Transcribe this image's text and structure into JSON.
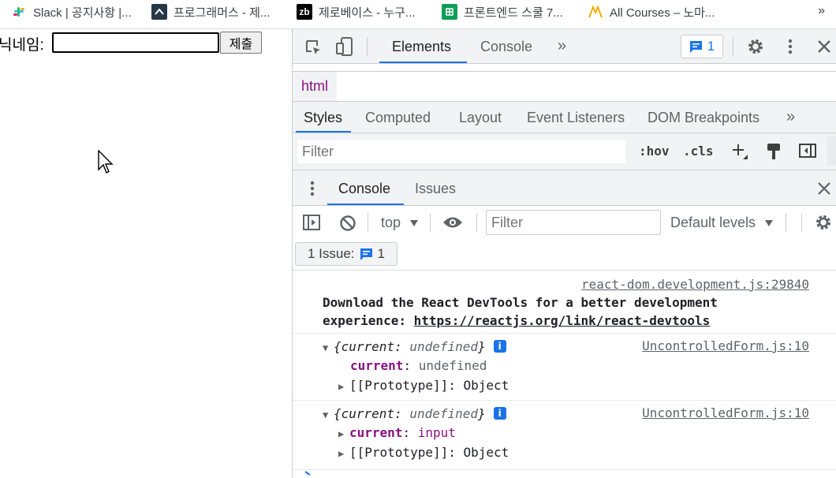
{
  "bookmarks": [
    {
      "label": "Slack | 공지사항 |...",
      "icon": "slack-icon",
      "color": "#e01e5a"
    },
    {
      "label": "프로그래머스 - 제...",
      "icon": "programmers-icon",
      "color": "#263747"
    },
    {
      "label": "제로베이스 - 누구...",
      "icon": "zerobase-icon",
      "color": "#000000",
      "glyph": "zb"
    },
    {
      "label": "프론트엔드 스쿨 7...",
      "icon": "sheets-icon",
      "color": "#0f9d58"
    },
    {
      "label": "All Courses – 노마...",
      "icon": "nomad-icon",
      "color": "#f9ab00"
    }
  ],
  "bookmarks_more": "»",
  "page": {
    "label": "닉네임:",
    "input_value": "",
    "submit_label": "제출"
  },
  "devtools": {
    "tabs": [
      "Elements",
      "Console"
    ],
    "more": "»",
    "issue_count": "1",
    "breadcrumb": "html",
    "styles_tabs": [
      "Styles",
      "Computed",
      "Layout",
      "Event Listeners",
      "DOM Breakpoints"
    ],
    "styles_filter_placeholder": "Filter",
    "hov": ":hov",
    "cls": ".cls",
    "drawer_tabs": [
      "Console",
      "Issues"
    ],
    "context": "top",
    "console_filter_placeholder": "Filter",
    "levels": "Default levels",
    "issues_label": "1 Issue:",
    "issues_count": "1"
  },
  "console_messages": [
    {
      "source": "react-dom.development.js:29840",
      "line1": "Download the React DevTools for a better development",
      "line2_prefix": "experience: ",
      "link": "https://reactjs.org/link/react-devtools"
    },
    {
      "source": "UncontrolledForm.js:10",
      "summary_key": "current",
      "summary_value": "undefined",
      "prop_key": "current",
      "prop_value": "undefined",
      "proto": "[[Prototype]]",
      "proto_value": "Object"
    },
    {
      "source": "UncontrolledForm.js:10",
      "summary_key": "current",
      "summary_value": "undefined",
      "prop_key": "current",
      "prop_value": "input",
      "proto": "[[Prototype]]",
      "proto_value": "Object"
    }
  ]
}
